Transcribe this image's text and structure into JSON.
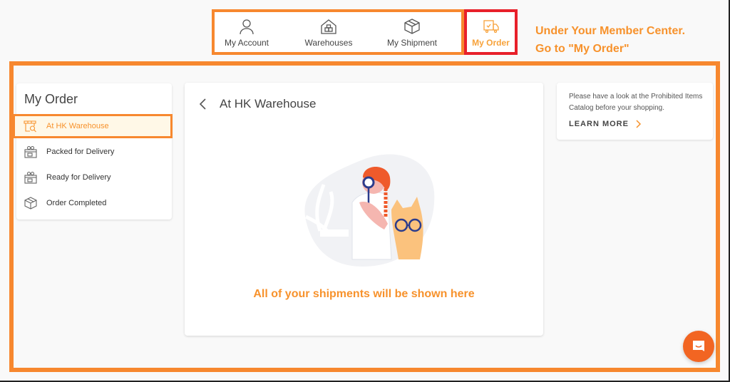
{
  "nav": {
    "items": [
      {
        "label": "My Account",
        "icon": "user-icon"
      },
      {
        "label": "Warehouses",
        "icon": "warehouse-icon"
      },
      {
        "label": "My Shipment",
        "icon": "box-icon"
      },
      {
        "label": "My Order",
        "icon": "delivery-truck-icon",
        "active": true
      }
    ]
  },
  "annotation": {
    "line1": "Under Your Member Center.",
    "line2": "Go to \"My Order\""
  },
  "sidebar": {
    "title": "My Order",
    "items": [
      {
        "label": "At HK Warehouse",
        "icon": "warehouse-search-icon",
        "active": true
      },
      {
        "label": "Packed for Delivery",
        "icon": "gift-package-icon"
      },
      {
        "label": "Ready for Delivery",
        "icon": "gift-package-icon"
      },
      {
        "label": "Order Completed",
        "icon": "box-icon"
      }
    ]
  },
  "main": {
    "title": "At HK Warehouse",
    "empty_message": "All of your shipments will be shown here"
  },
  "info": {
    "text": "Please have a look at the Prohibited Items Catalog before your shopping.",
    "link_label": "LEARN MORE"
  },
  "colors": {
    "accent": "#f7922c",
    "highlight_frame": "#f7882f",
    "active_box": "#e8202a",
    "chat": "#f26522"
  }
}
